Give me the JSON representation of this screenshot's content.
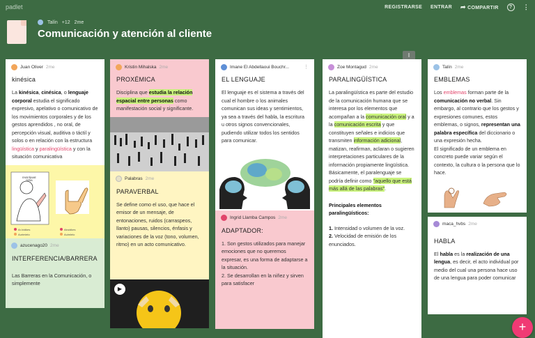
{
  "topbar": {
    "brand": "padlet",
    "register": "REGISTRARSE",
    "login": "ENTRAR",
    "share": "COMPARTIR",
    "help_icon": "?",
    "more_icon": "⋮"
  },
  "header": {
    "author": "Talín",
    "collaborators": "+12",
    "age": "2me",
    "title": "Comunicación y atención al cliente"
  },
  "scroll_badge": "I",
  "columns": {
    "c1": {
      "card1": {
        "author": "Juan Oliver",
        "time": "2me",
        "title": "kinésica",
        "body": [
          "La ",
          "kinésica",
          ", ",
          "cinésica",
          ", o ",
          "lenguaje corporal",
          " estudia el significado expresivo, apelativo o comunicativo de los movimientos corporales y de los gestos aprendidos , no oral, de percepción visual, auditiva o táctil y solos o en relación con la estructura ",
          "lingüística",
          " y ",
          "paralingüística",
          " y con la situación comunicativa"
        ]
      },
      "card1_img": {
        "sign_text": "ENSEÑAME\nSEÑA",
        "legend1": "Ar.Ividkes",
        "legend2": "Aurimlelo",
        "legend3": "Alruidkes",
        "legend4": "Auimlelo"
      },
      "card2": {
        "author": "azucenago20",
        "time": "2me",
        "title": "INTERFERENCIA/BARRERA",
        "body": "Las Barreras en la Comunicación, o simplemente"
      }
    },
    "c2": {
      "card1": {
        "author": "Kristin Mihalska",
        "time": "2me",
        "title": "PROXÉMICA",
        "body": [
          "Disciplina que ",
          "estudia la relación espacial entre personas",
          " como manifestación social y significante."
        ]
      },
      "card2": {
        "author": "Palabras",
        "time": "2me",
        "title": "PARAVERBAL",
        "body": "Se define como el uso, que hace el emisor de un mensaje, de entonaciones, ruidos (carraspeos, llanto) pausas, silencios, énfasis y variaciones de la voz (tono, volumen, ritmo) en un acto comunicativo."
      }
    },
    "c3": {
      "card1": {
        "author": "Imane El Abdellaoui Bouchr...",
        "time": "",
        "title": "EL LENGUAJE",
        "body": "El lenguaje es el sistema a través del cual el hombre o los animales comunican sus ideas y sentimientos, ya sea a través del habla, la escritura u otros signos convencionales, pudiendo utilizar todos los sentidos para comunicar."
      },
      "card2": {
        "author": "Ingrid Llamba Campos",
        "time": "2me",
        "title": "ADAPTADOR:",
        "body": "1. Son gestos utilizados  para manejar emociones que no queremos expresar, es una forma de adaptarse a la situación.\n2. Se desarrollan en la niñez y sirven para satisfacer"
      }
    },
    "c4": {
      "card1": {
        "author": "Zoe Montagud",
        "time": "2me",
        "title": "PARALINGÜÍSTICA",
        "body": [
          "La paralingüística es parte del estudio de la comunicación humana que se interesa por los elementos que acompañan a la ",
          "comunicación oral",
          " y a la ",
          "comunicación escrita",
          " y que constituyen señales e indicios que transmiten ",
          "información adicional",
          ", matizan, reafirman, aclaran o sugieren interpretaciones particulares de la información propiamente lingüística. Básicamente, el paralenguaje se podría definir como ",
          "\"aquello que está más allá de las palabras\"",
          "."
        ],
        "subhead": "Principales elementos paralingüísticos:",
        "list": [
          "1.",
          " Intensidad o volumen de la voz.",
          "2.",
          " Velocidad de emisión de los enunciados."
        ]
      }
    },
    "c5": {
      "card1": {
        "author": "Talín",
        "time": "2me",
        "title": "EMBLEMAS",
        "body": [
          "Los ",
          "emblemas",
          " forman parte de la ",
          "comunicación no verbal",
          ". Sin embargo, al contrario que los gestos y expresiones comunes, estos emblemas, o signos, ",
          "representan una palabra específica",
          " del diccionario o una expresión hecha.",
          "El significado de un emblema en concreto puede variar según el contexto, la cultura o la persona que lo hace."
        ]
      },
      "card2": {
        "author": "maca_hvbs",
        "time": "2me",
        "title": "HABLA",
        "body": [
          "El ",
          "habla",
          " es la ",
          "realización de una lengua",
          ", es decir, el acto individual por medio del cual una persona hace uso de una lengua para poder comunicar"
        ]
      }
    }
  },
  "fab_label": "+",
  "colors": {
    "background": "#3d6b43",
    "pink": "#f9c9cf",
    "yellow": "#fff5c2",
    "highlight": "#c9f27c",
    "accent": "#f03a74"
  },
  "icons": [
    "share-icon",
    "help-icon",
    "more-icon",
    "play-icon",
    "add-icon",
    "avatar"
  ]
}
